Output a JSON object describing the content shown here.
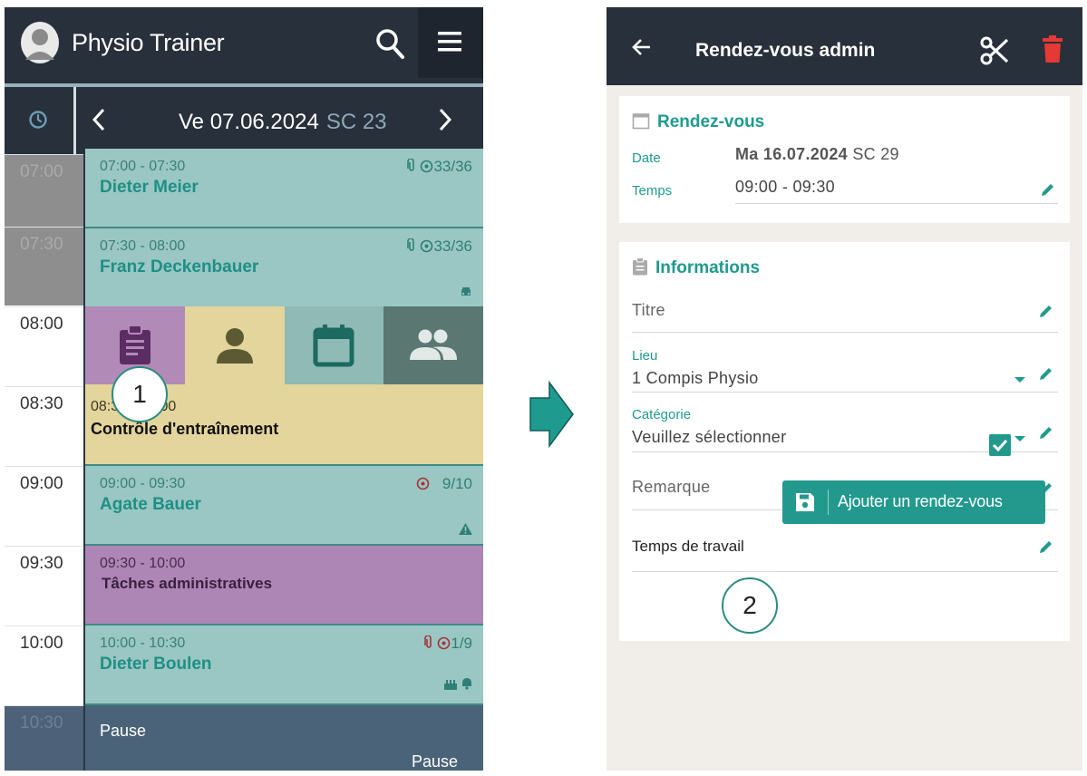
{
  "left_app": {
    "title": "Physio Trainer",
    "date_nav": {
      "date": "Ve 07.06.2024",
      "week": "SC 23"
    },
    "times": [
      "07:00",
      "07:30",
      "08:00",
      "08:30",
      "09:00",
      "09:30",
      "10:00",
      "10:30"
    ],
    "events": [
      {
        "time": "07:00 - 07:30",
        "name": "Dieter Meier",
        "meta": "33/36"
      },
      {
        "time": "07:30 - 08:00",
        "name": "Franz Deckenbauer",
        "meta": "33/36"
      },
      {
        "time": "08:30 - 09:00",
        "name": "Contrôle d'entraînement"
      },
      {
        "time": "09:00 - 09:30",
        "name": "Agate Bauer",
        "meta": "9/10"
      },
      {
        "time": "09:30 - 10:00",
        "name": "Tâches administratives"
      },
      {
        "time": "10:00 - 10:30",
        "name": "Dieter Boulen",
        "meta": "1/9"
      },
      {
        "time": "Pause",
        "name": "Pause"
      }
    ],
    "badge_1": "1"
  },
  "right_app": {
    "title": "Rendez-vous admin",
    "appointment": {
      "heading": "Rendez-vous",
      "date_label": "Date",
      "date_value": "Ma 16.07.2024",
      "date_week": "SC 29",
      "time_label": "Temps",
      "time_value": "09:00 - 09:30"
    },
    "informations": {
      "heading": "Informations",
      "title_placeholder": "Titre",
      "lieu_label": "Lieu",
      "lieu_value": "1 Compis Physio",
      "categorie_label": "Catégorie",
      "categorie_value": "Veuillez sélectionner",
      "remarque_placeholder": "Remarque",
      "work_time_label": "Temps de travail",
      "work_time_checked": true,
      "save_label": "Ajouter un rendez-vous"
    },
    "badge_2": "2"
  },
  "colors": {
    "appbar": "#27303b",
    "teal": "#23998e",
    "event_teal": "#9ac7c3",
    "event_yellow": "#e3d59b",
    "event_purple": "#ad86b5",
    "pause": "#4b6378",
    "delete_red": "#e53935"
  }
}
